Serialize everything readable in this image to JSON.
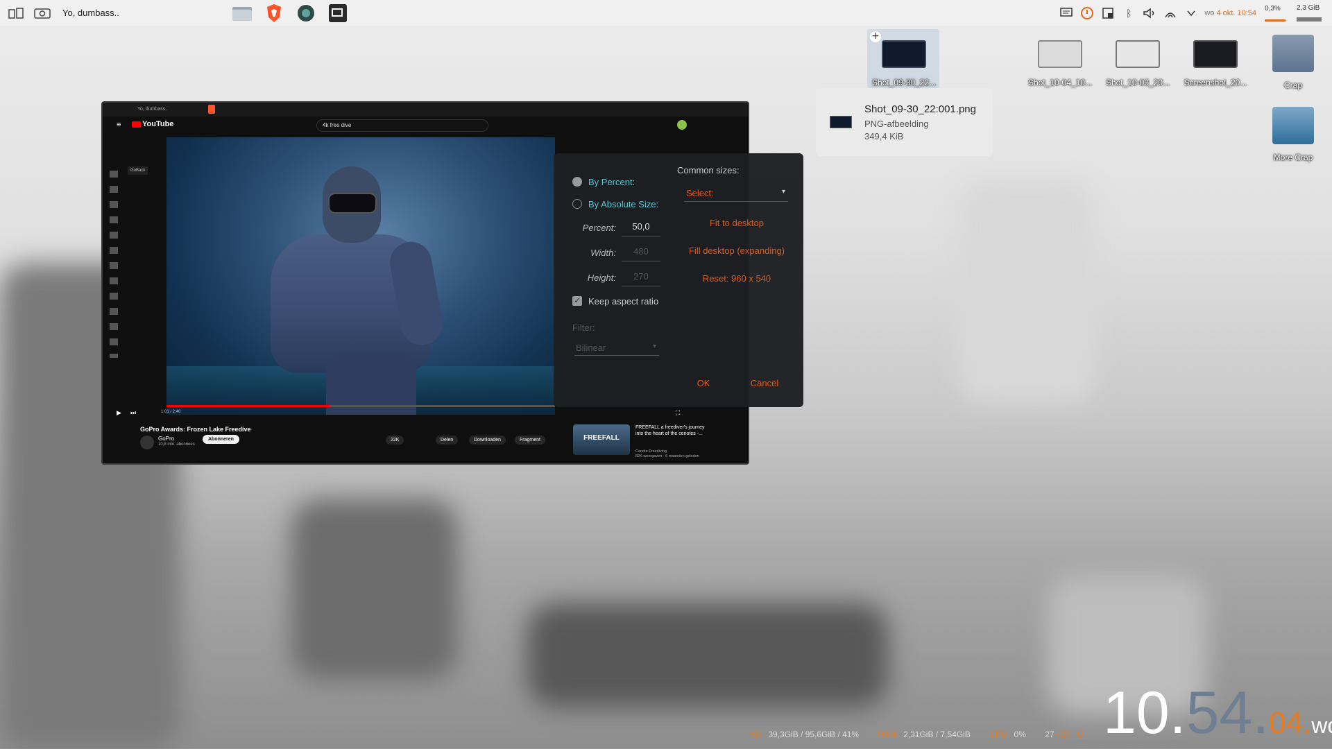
{
  "panel": {
    "window_title": "Yo, dumbass..",
    "clock_date": "wo",
    "clock_date_hl": "4 okt.",
    "clock_time": "10:54",
    "cpu_meter": "0,3%",
    "ram_meter": "2,3 GiB"
  },
  "desktop_icons": [
    {
      "label": "Shot_09-30_22..."
    },
    {
      "label": "Shot_10-04_10..."
    },
    {
      "label": "Shot_10-03_20..."
    },
    {
      "label": "Screenshot_20..."
    },
    {
      "label": "Crap"
    },
    {
      "label": "More Crap"
    }
  ],
  "tooltip": {
    "name": "Shot_09-30_22:001.png",
    "type": "PNG-afbeelding",
    "size": "349,4 KiB"
  },
  "preview": {
    "mini_title": "Yo, dumbass..",
    "yt_logo": "YouTube",
    "search": "4k free dive",
    "video_time": "1:01 / 2:40",
    "video_title": "GoPro Awards: Frozen Lake Freedive",
    "channel": "GoPro",
    "subs": "10,8 mln. abonnees",
    "subscribe": "Abonneren",
    "likes": "22K",
    "share": "Delen",
    "download": "Downloaden",
    "clip": "Fragment",
    "rec_thumb": "FREEFALL",
    "rec_title": "FREEFALL a freediver's journey into the heart of the cenotes -...",
    "rec_channel": "Cenote Freediving",
    "rec_meta": "82K weergaven · 6 maanden geleden",
    "sidebar_tip": "GoBack"
  },
  "dialog": {
    "by_percent": "By Percent:",
    "by_absolute": "By Absolute Size:",
    "percent_label": "Percent:",
    "percent_value": "50,0",
    "width_label": "Width:",
    "width_value": "480",
    "height_label": "Height:",
    "height_value": "270",
    "keep_aspect": "Keep aspect ratio",
    "filter_label": "Filter:",
    "filter_value": "Bilinear",
    "common_sizes": "Common sizes:",
    "select": "Select:",
    "fit": "Fit to desktop",
    "fill": "Fill desktop (expanding)",
    "reset": "Reset: 960 x 540",
    "ok": "OK",
    "cancel": "Cancel"
  },
  "bigclock": {
    "hour": "10.",
    "minute": "54.",
    "second": "04.",
    "day": "wo"
  },
  "sysbar": {
    "hd_label": "HD",
    "hd_value": "39,3GiB / 95,6GiB / 41%",
    "ram_label": "RAM",
    "ram_value": "2,31GiB / 7,54GiB",
    "cpu_label": "CPU",
    "cpu_value": "0%",
    "temp_value": "27",
    "temp_rest": "/ 27",
    "temp_unit": "°C"
  },
  "colors": {
    "accent": "#e25a1c",
    "cyan": "#57c7d4"
  }
}
